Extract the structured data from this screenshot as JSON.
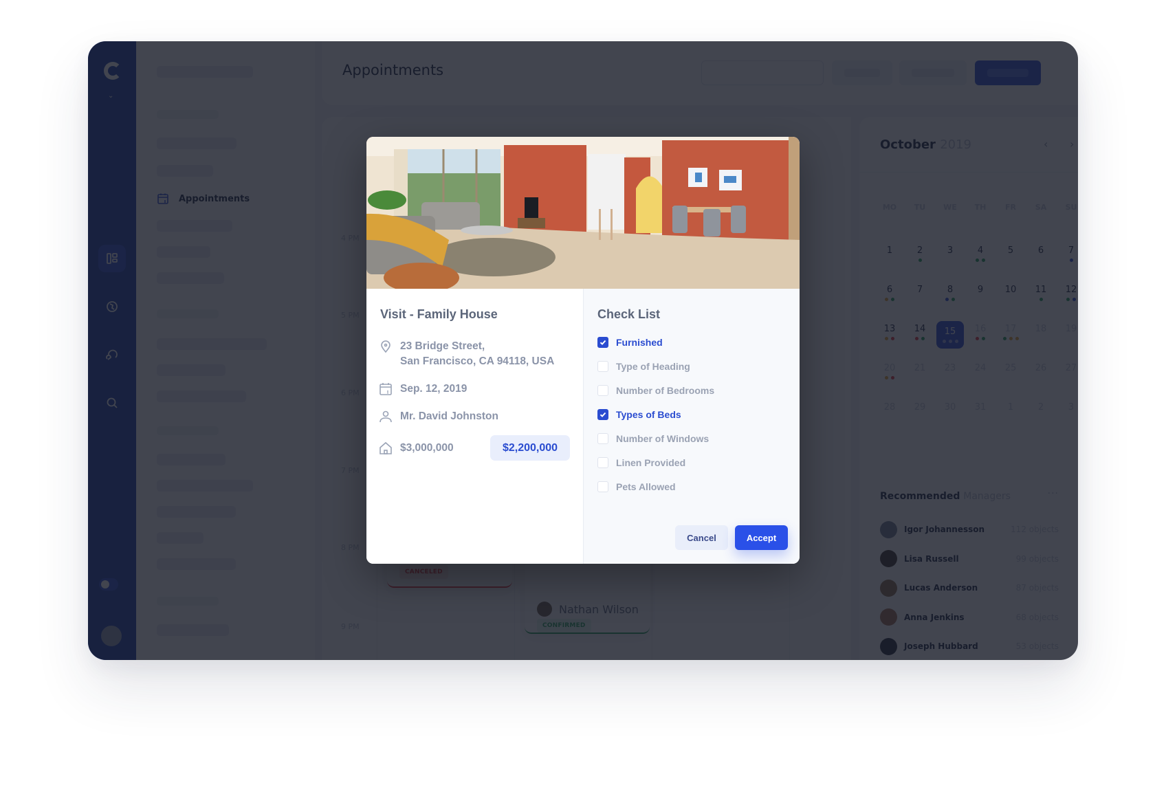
{
  "header": {
    "title": "Appointments"
  },
  "sidebar": {
    "active_item": {
      "label": "Appointments",
      "icon": "calendar-icon"
    },
    "rail_icons": [
      "dashboard-icon",
      "globe-icon",
      "chat-icon",
      "search-icon"
    ]
  },
  "schedule": {
    "time_labels": [
      "4 PM",
      "5 PM",
      "6 PM",
      "7 PM",
      "8 PM",
      "9 PM"
    ],
    "cards": [
      {
        "status": "CANCELED",
        "status_color": "#e0303a"
      },
      {
        "person": "Nathan Wilson",
        "status": "CONFIRMED",
        "status_color": "#1f9d55"
      }
    ]
  },
  "calendar": {
    "month": "October",
    "year": "2019",
    "prev_icon": "chevron-left-icon",
    "next_icon": "chevron-right-icon",
    "weekdays": [
      "MO",
      "TU",
      "WE",
      "TH",
      "FR",
      "SA",
      "SU"
    ],
    "days": [
      {
        "d": "1",
        "dots": []
      },
      {
        "d": "2",
        "dots": [
          "#1f9d55"
        ]
      },
      {
        "d": "3",
        "dots": []
      },
      {
        "d": "4",
        "dots": [
          "#1f9d55",
          "#1f9d55"
        ]
      },
      {
        "d": "5",
        "dots": []
      },
      {
        "d": "6",
        "dots": []
      },
      {
        "d": "7",
        "dots": [
          "#2a4cd0"
        ]
      },
      {
        "d": "6",
        "dots": [
          "#e0a030",
          "#1f9d55"
        ]
      },
      {
        "d": "7",
        "dots": []
      },
      {
        "d": "8",
        "dots": [
          "#2a4cd0",
          "#1f9d55"
        ]
      },
      {
        "d": "9",
        "dots": []
      },
      {
        "d": "10",
        "dots": []
      },
      {
        "d": "11",
        "dots": [
          "#1f9d55"
        ]
      },
      {
        "d": "12",
        "dots": [
          "#1f9d55",
          "#2a4cd0"
        ]
      },
      {
        "d": "13",
        "dots": [
          "#e0a030",
          "#e0303a"
        ]
      },
      {
        "d": "14",
        "dots": [
          "#e0303a",
          "#1f9d55"
        ]
      },
      {
        "d": "15",
        "today": true,
        "dots": [
          "#ffffff",
          "#ffffff",
          "#ffffff"
        ]
      },
      {
        "d": "16",
        "muted": true,
        "dots": [
          "#e0303a",
          "#1f9d55"
        ]
      },
      {
        "d": "17",
        "muted": true,
        "dots": [
          "#1f9d55",
          "#e0a030",
          "#e0a030"
        ]
      },
      {
        "d": "18",
        "muted": true,
        "dots": []
      },
      {
        "d": "19",
        "muted": true,
        "dots": []
      },
      {
        "d": "20",
        "muted": true,
        "dots": [
          "#e0a030",
          "#e0303a"
        ]
      },
      {
        "d": "21",
        "muted": true,
        "dots": []
      },
      {
        "d": "23",
        "muted": true,
        "dots": []
      },
      {
        "d": "24",
        "muted": true,
        "dots": []
      },
      {
        "d": "25",
        "muted": true,
        "dots": []
      },
      {
        "d": "26",
        "muted": true,
        "dots": []
      },
      {
        "d": "27",
        "muted": true,
        "dots": []
      },
      {
        "d": "28",
        "muted": true,
        "dots": []
      },
      {
        "d": "29",
        "muted": true,
        "dots": []
      },
      {
        "d": "30",
        "muted": true,
        "dots": []
      },
      {
        "d": "31",
        "muted": true,
        "dots": []
      },
      {
        "d": "1",
        "muted": true,
        "dots": []
      },
      {
        "d": "2",
        "muted": true,
        "dots": []
      },
      {
        "d": "3",
        "muted": true,
        "dots": []
      }
    ]
  },
  "recommended": {
    "title": "Recommended",
    "subtitle": "Managers",
    "more_icon": "more-horizontal-icon",
    "managers": [
      {
        "name": "Igor Johannesson",
        "count": "112 objects",
        "avatar_color": "#6d7a90"
      },
      {
        "name": "Lisa Russell",
        "count": "99 objects",
        "avatar_color": "#3a2f2a"
      },
      {
        "name": "Lucas Anderson",
        "count": "87 objects",
        "avatar_color": "#8a6a4a"
      },
      {
        "name": "Anna Jenkins",
        "count": "68 objects",
        "avatar_color": "#a06a50"
      },
      {
        "name": "Joseph Hubbard",
        "count": "53 objects",
        "avatar_color": "#1e2535"
      }
    ]
  },
  "modal": {
    "photo_alt": "Living room with brick wall and dining area",
    "title": "Visit - Family House",
    "address_line1": "23 Bridge Street,",
    "address_line2": "San Francisco, CA 94118, USA",
    "date": "Sep. 12, 2019",
    "client": "Mr. David Johnston",
    "price_original": "$3,000,000",
    "price_offer": "$2,200,000",
    "checklist_title": "Check List",
    "checklist": [
      {
        "label": "Furnished",
        "checked": true
      },
      {
        "label": "Type of Heading",
        "checked": false
      },
      {
        "label": "Number of Bedrooms",
        "checked": false
      },
      {
        "label": "Types of Beds",
        "checked": true
      },
      {
        "label": "Number of Windows",
        "checked": false
      },
      {
        "label": "Linen Provided",
        "checked": false
      },
      {
        "label": "Pets Allowed",
        "checked": false
      }
    ],
    "cancel_label": "Cancel",
    "accept_label": "Accept"
  }
}
